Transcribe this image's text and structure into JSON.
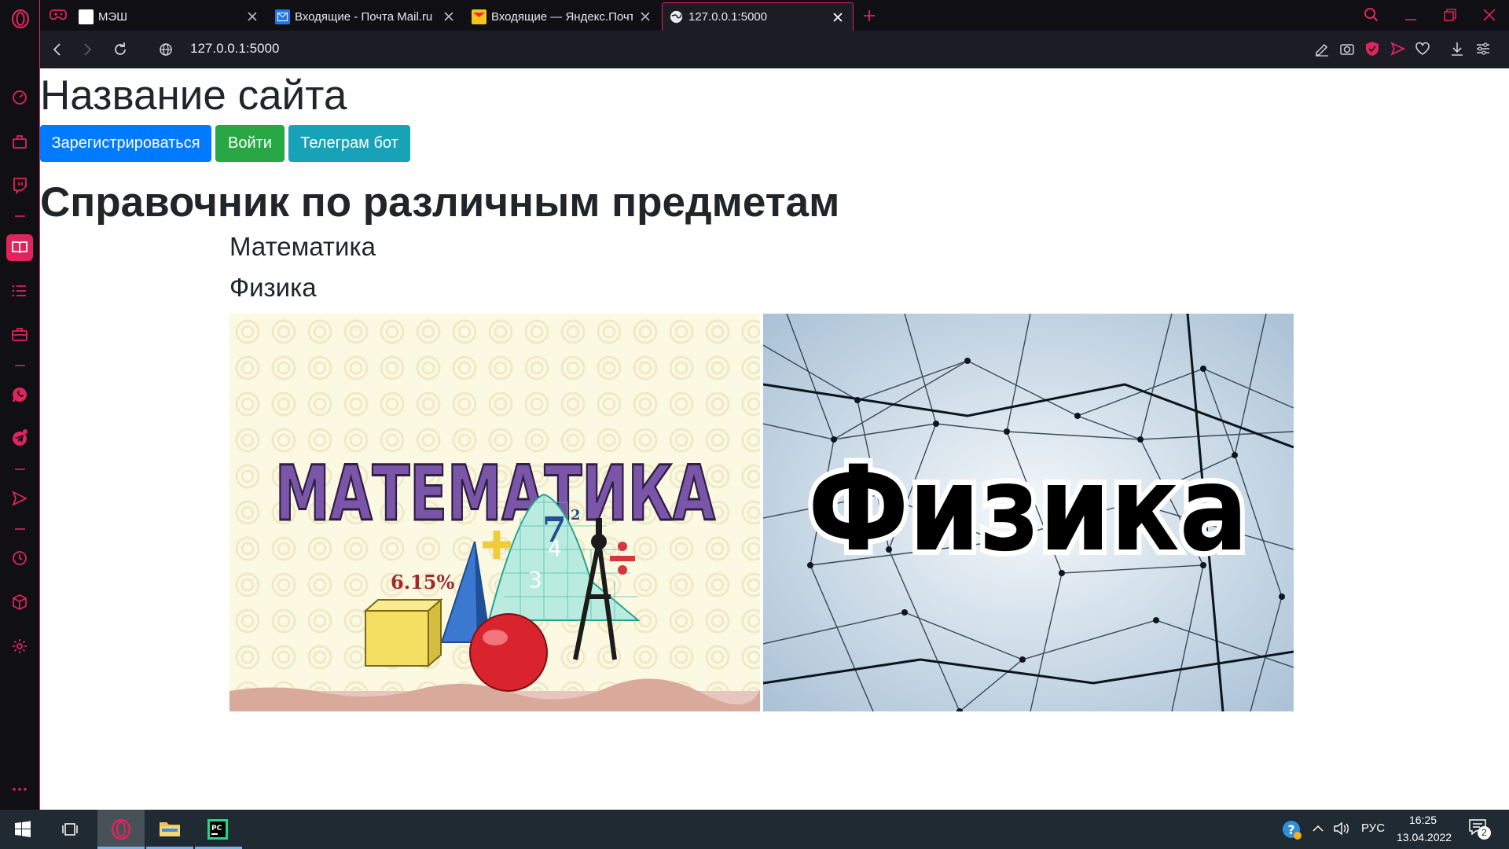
{
  "browser": {
    "tabs": [
      {
        "title": "МЭШ"
      },
      {
        "title": "Входящие - Почта Mail.ru"
      },
      {
        "title": "Входящие — Яндекс.Почта"
      },
      {
        "title": "127.0.0.1:5000"
      }
    ],
    "url": "127.0.0.1:5000",
    "accent_color": "#e0245e"
  },
  "page": {
    "site_title": "Название сайта",
    "buttons": {
      "register": "Зарегистрироваться",
      "login": "Войти",
      "telegram": "Телеграм бот"
    },
    "section_title": "Справочник по различным предметам",
    "subjects": [
      "Математика",
      "Физика"
    ],
    "images": [
      {
        "caption": "МАТЕМАТИКА",
        "labels": [
          "7",
          "2",
          "6.15%",
          "4",
          "3"
        ]
      },
      {
        "caption": "Физика"
      }
    ]
  },
  "taskbar": {
    "language": "РУС",
    "time": "16:25",
    "date": "13.04.2022",
    "notifications": "2"
  }
}
